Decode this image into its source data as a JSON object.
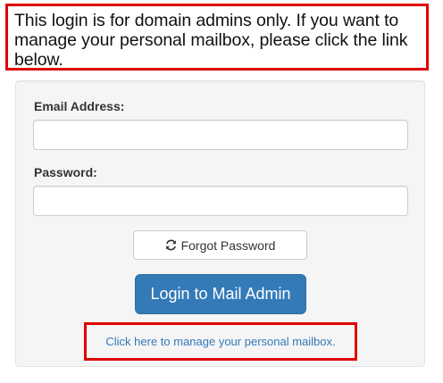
{
  "notice": {
    "text": "This login is for domain admins only. If you want to manage your personal mailbox, please click the link below.",
    "border_color": "#e00000"
  },
  "form": {
    "email_label": "Email Address:",
    "email_value": "",
    "password_label": "Password:",
    "password_value": "",
    "forgot_label": "Forgot Password",
    "forgot_icon": "refresh-icon",
    "login_label": "Login to Mail Admin",
    "login_color": "#337ab7",
    "personal_link": "Click here to manage your personal mailbox.",
    "link_color": "#337ab7"
  }
}
